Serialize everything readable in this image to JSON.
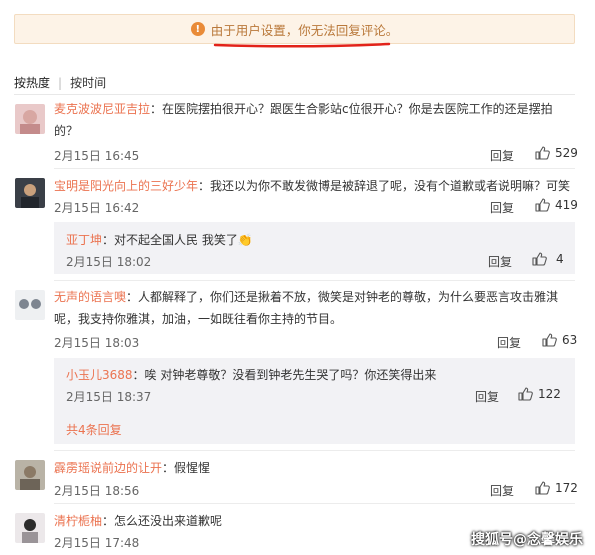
{
  "notice": {
    "text": "由于用户设置，你无法回复评论。",
    "icon": "warning-icon",
    "accent": "#e98b38"
  },
  "sort": {
    "hot": "按热度",
    "time": "按时间"
  },
  "reply_label": "回复",
  "comments": [
    {
      "user": "麦克波波尼亚吉拉",
      "text": "：在医院摆拍很开心？跟医生合影站c位很开心？你是去医院工作的还是摆拍的？",
      "date": "2月15日 16:45",
      "likes": "529"
    },
    {
      "user": "宝明是阳光向上的三好少年",
      "text": "：我还以为你不敢发微博是被辞退了呢，没有个道歉或者说明嘛？可笑",
      "date": "2月15日 16:42",
      "likes": "419",
      "sub": {
        "user": "亚丁坤",
        "text": "：对不起全国人民 我笑了",
        "date": "2月15日 18:02",
        "likes": "4"
      }
    },
    {
      "user": "无声的语言噢",
      "text": "：人都解释了，你们还是揪着不放，微笑是对钟老的尊敬，为什么要恶言攻击雅淇呢，我支持你雅淇，加油，一如既往看你主持的节目。",
      "date": "2月15日 18:03",
      "likes": "63",
      "sub": {
        "user": "小玉儿3688",
        "text": "：唉 对钟老尊敬？没看到钟老先生哭了吗？你还笑得出来",
        "date": "2月15日 18:37",
        "likes": "122",
        "more": "共4条回复"
      }
    },
    {
      "user": "霹雳瑶说前边的让开",
      "text": "：假惺惺",
      "date": "2月15日 18:56",
      "likes": "172"
    },
    {
      "user": "清柠栀柚",
      "text": "：怎么还没出来道歉呢",
      "date": "2月15日 17:48",
      "likes": ""
    }
  ],
  "watermark": "搜狐号@念馨娱乐"
}
